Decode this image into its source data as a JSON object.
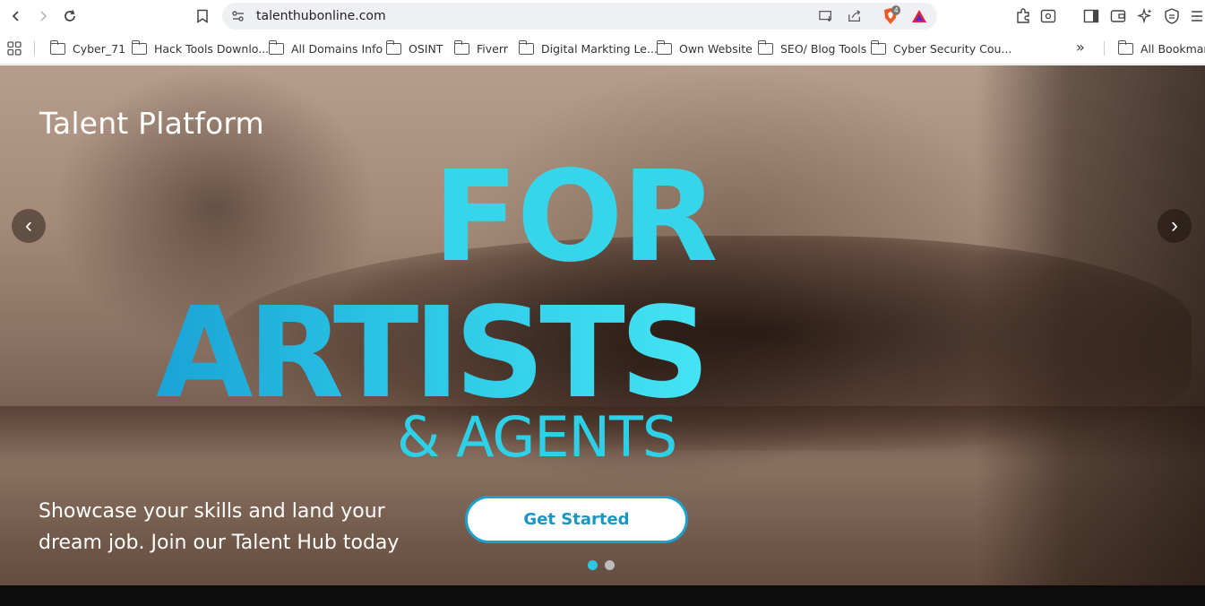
{
  "browser": {
    "url": "talenthubonline.com",
    "extension_badge": "4",
    "bookmarks": [
      {
        "label": "Cyber_71"
      },
      {
        "label": "Hack Tools Downlo..."
      },
      {
        "label": "All Domains Info"
      },
      {
        "label": "OSINT"
      },
      {
        "label": "Fiverr"
      },
      {
        "label": "Digital Markting Le..."
      },
      {
        "label": "Own Website"
      },
      {
        "label": "SEO/ Blog Tools"
      },
      {
        "label": "Cyber Security Cou..."
      }
    ],
    "overflow_label": "»",
    "all_bookmarks_label": "All Bookmarks"
  },
  "hero": {
    "brand": "Talent Platform",
    "headline_line1": "FOR",
    "headline_line2": "ARTISTS",
    "headline_line3": "& AGENTS",
    "tagline": "Showcase your skills and land your dream job. Join our Talent Hub today",
    "cta_label": "Get Started",
    "prev_glyph": "‹",
    "next_glyph": "›",
    "slide_count": 2,
    "active_slide": 1
  },
  "colors": {
    "accent": "#2ec6e6",
    "cta_border": "#1ea0cf",
    "footer": "#0c0c0c"
  },
  "icons": [
    "back-icon",
    "forward-icon",
    "reload-icon",
    "bookmark-star-icon",
    "site-settings-icon",
    "install-icon",
    "share-icon",
    "brave-shield-icon",
    "brave-rewards-icon",
    "extensions-icon",
    "reader-icon",
    "sidebar-icon",
    "wallet-icon",
    "leo-ai-icon",
    "vpn-icon",
    "menu-icon",
    "apps-grid-icon",
    "folder-icon"
  ]
}
